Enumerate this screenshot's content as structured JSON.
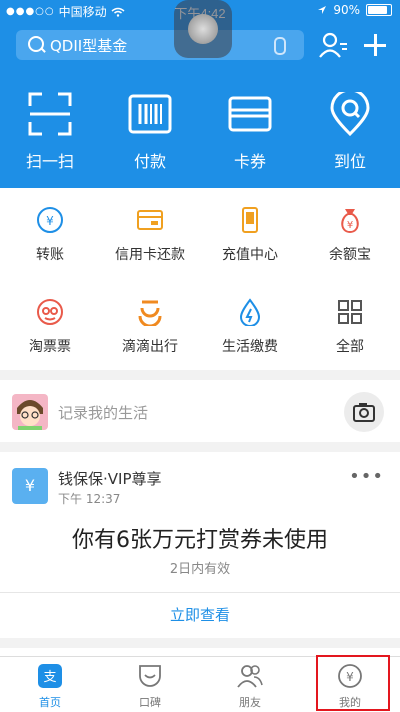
{
  "status_bar": {
    "signal": "●●●○○",
    "carrier": "中国移动",
    "time": "下午4:42",
    "battery": "90%"
  },
  "search": {
    "placeholder": "QDII型基金"
  },
  "top_actions": [
    {
      "label": "扫一扫",
      "icon": "scan-icon"
    },
    {
      "label": "付款",
      "icon": "barcode-icon"
    },
    {
      "label": "卡券",
      "icon": "card-wallet-icon"
    },
    {
      "label": "到位",
      "icon": "location-pin-icon"
    }
  ],
  "services": [
    {
      "label": "转账",
      "icon": "transfer-icon"
    },
    {
      "label": "信用卡还款",
      "icon": "credit-card-icon"
    },
    {
      "label": "充值中心",
      "icon": "phone-recharge-icon"
    },
    {
      "label": "余额宝",
      "icon": "money-bag-icon"
    },
    {
      "label": "淘票票",
      "icon": "movie-ticket-icon"
    },
    {
      "label": "滴滴出行",
      "icon": "didi-icon"
    },
    {
      "label": "生活缴费",
      "icon": "utility-drop-icon"
    },
    {
      "label": "全部",
      "icon": "grid-all-icon"
    }
  ],
  "post": {
    "placeholder": "记录我的生活"
  },
  "card": {
    "name": "钱保保·VIP尊享",
    "time": "下午 12:37",
    "headline": "你有6张万元打赏券未使用",
    "sub": "2日内有效",
    "link": "立即查看",
    "logo_symbol": "¥"
  },
  "tabs": [
    {
      "label": "首页",
      "icon": "home-alipay-icon"
    },
    {
      "label": "口碑",
      "icon": "koubei-icon"
    },
    {
      "label": "朋友",
      "icon": "friends-icon"
    },
    {
      "label": "我的",
      "icon": "wallet-me-icon"
    }
  ],
  "colors": {
    "primary": "#1e8fe6",
    "highlight": "#e3161e"
  }
}
